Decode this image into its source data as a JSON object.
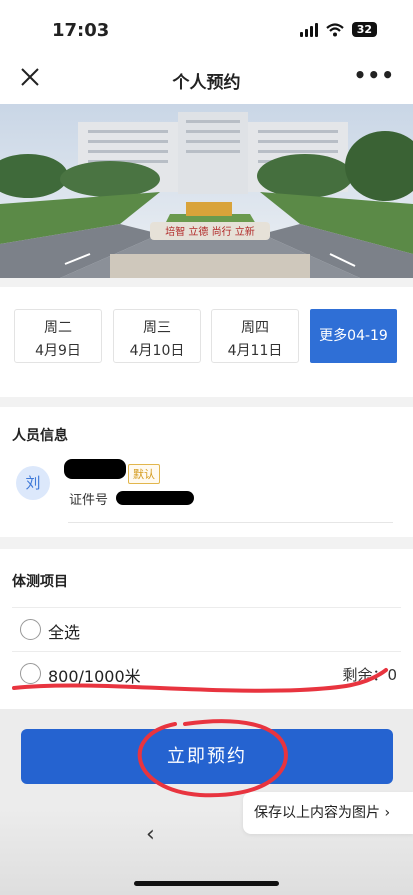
{
  "status_bar": {
    "time": "17:03",
    "battery": "32"
  },
  "nav": {
    "title": "个人预约",
    "more": "•••"
  },
  "banner": {
    "sign_text": "培智 立德 尚行 立新"
  },
  "dates": [
    {
      "weekday": "周二",
      "date": "4月9日"
    },
    {
      "weekday": "周三",
      "date": "4月10日"
    },
    {
      "weekday": "周四",
      "date": "4月11日"
    }
  ],
  "date_more": "更多04-19",
  "person": {
    "section_title": "人员信息",
    "avatar_char": "刘",
    "default_badge": "默认",
    "id_label": "证件号"
  },
  "tests": {
    "section_title": "体测项目",
    "select_all": "全选",
    "item_label": "800/1000米",
    "remain_label": "剩余：",
    "remain_value": "0"
  },
  "actions": {
    "book_button": "立即预约",
    "save_image": "保存以上内容为图片 ›",
    "back": "‹"
  },
  "colors": {
    "accent": "#2f6fd6",
    "button": "#2563d0",
    "annotation": "#e8343f"
  }
}
